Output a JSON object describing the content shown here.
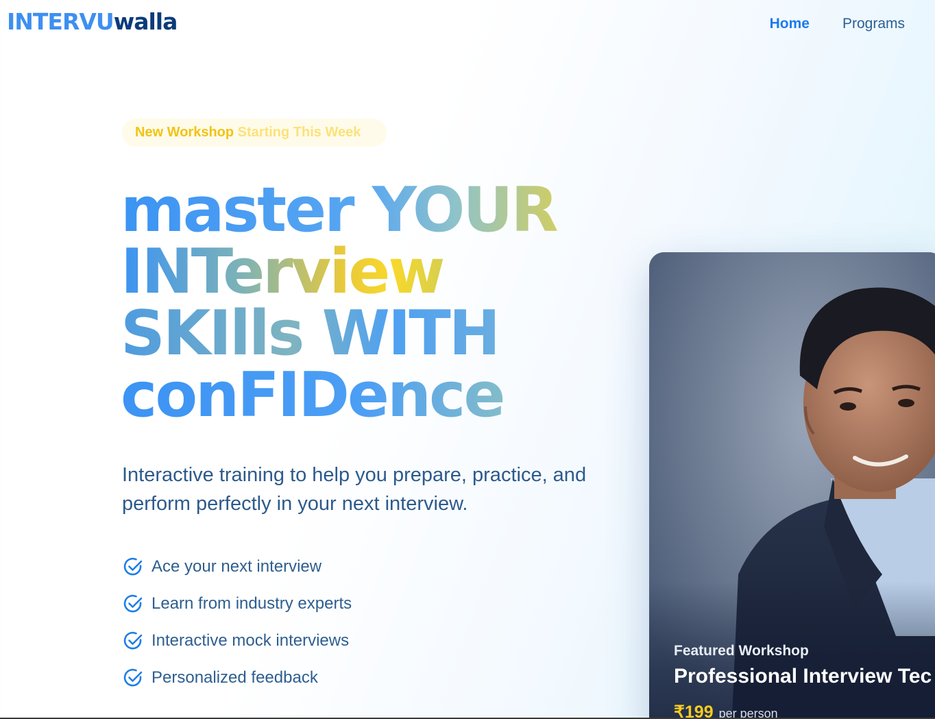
{
  "brand": {
    "logo_part1": "INTERVU",
    "logo_part2": "walla"
  },
  "nav": {
    "home": "Home",
    "programs": "Programs"
  },
  "badge": {
    "part1": "New Workshop",
    "part2": "Starting This Week"
  },
  "hero": {
    "line1": "master YOUR",
    "line2": "INTerview",
    "line3": "SKIlls WITH",
    "line4": "conFIDence",
    "subtitle": "Interactive training to help you prepare, practice, and perform perfectly in your next interview."
  },
  "features": [
    "Ace your next interview",
    "Learn from industry experts",
    "Interactive mock interviews",
    "Personalized feedback"
  ],
  "featured_card": {
    "label": "Featured Workshop",
    "title": "Professional Interview Tec",
    "price": "₹199",
    "per": "per person"
  },
  "colors": {
    "primary_blue": "#3b93f3",
    "navy": "#0a3b7a",
    "accent_yellow": "#f7cb1f"
  },
  "icons": {
    "feature": "check-circle-icon"
  }
}
